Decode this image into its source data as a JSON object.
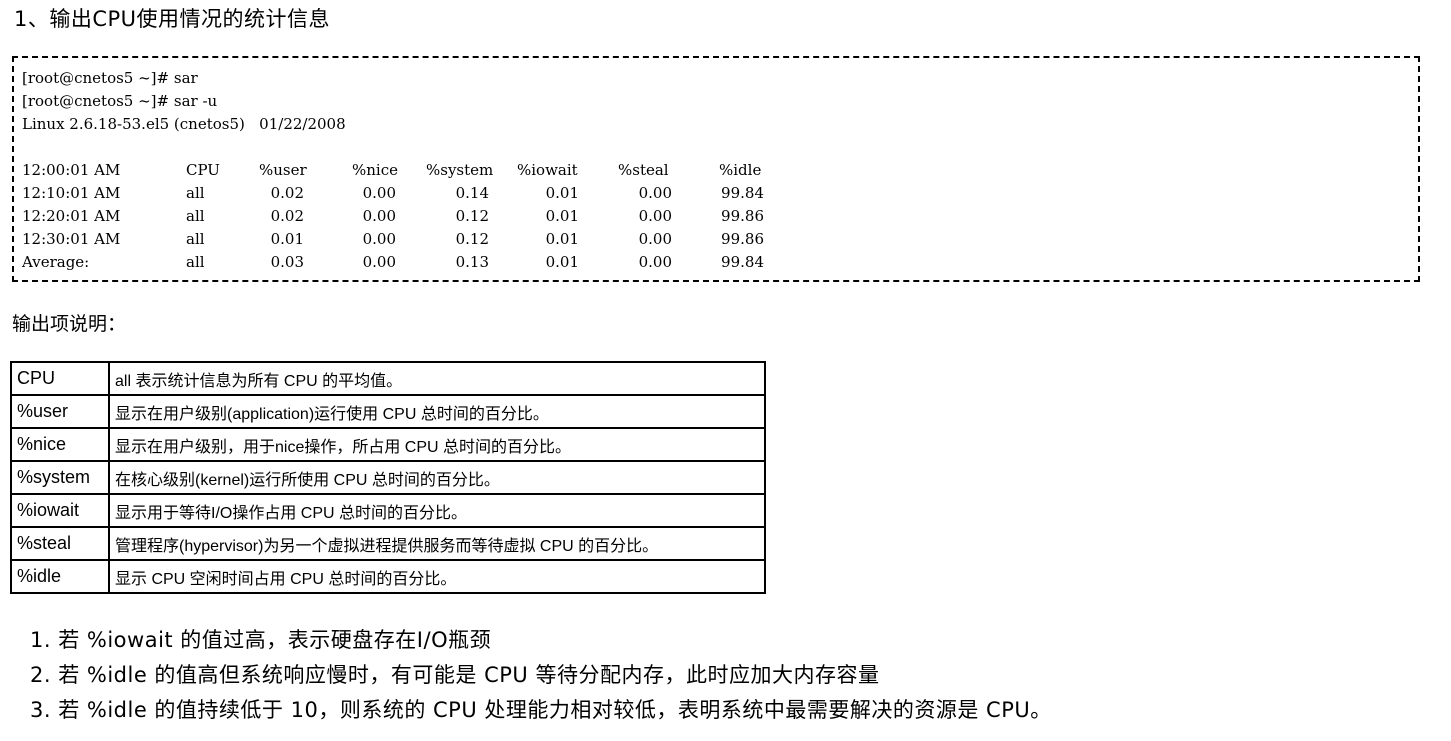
{
  "heading": "1、输出CPU使用情况的统计信息",
  "terminal": {
    "commands": [
      "[root@cnetos5 ~]# sar",
      "[root@cnetos5 ~]# sar -u"
    ],
    "sysinfo": "Linux 2.6.18-53.el5 (cnetos5)   01/22/2008",
    "columns": [
      "12:00:01 AM",
      "CPU",
      "%user",
      "%nice",
      "%system",
      "%iowait",
      "%steal",
      "%idle"
    ],
    "rows": [
      [
        "12:10:01 AM",
        "all",
        "0.02",
        "0.00",
        "0.14",
        "0.01",
        "0.00",
        "99.84"
      ],
      [
        "12:20:01 AM",
        "all",
        "0.02",
        "0.00",
        "0.12",
        "0.01",
        "0.00",
        "99.86"
      ],
      [
        "12:30:01 AM",
        "all",
        "0.01",
        "0.00",
        "0.12",
        "0.01",
        "0.00",
        "99.86"
      ],
      [
        "Average:",
        "all",
        "0.03",
        "0.00",
        "0.13",
        "0.01",
        "0.00",
        "99.84"
      ]
    ]
  },
  "subheading": "输出项说明：",
  "table": [
    {
      "key": "CPU",
      "desc": "all 表示统计信息为所有 CPU 的平均值。"
    },
    {
      "key": "%user",
      "desc": "显示在用户级别(application)运行使用 CPU 总时间的百分比。"
    },
    {
      "key": "%nice",
      "desc": "显示在用户级别，用于nice操作，所占用 CPU 总时间的百分比。"
    },
    {
      "key": "%system",
      "desc": "在核心级别(kernel)运行所使用 CPU 总时间的百分比。"
    },
    {
      "key": "%iowait",
      "desc": "显示用于等待I/O操作占用 CPU 总时间的百分比。"
    },
    {
      "key": "%steal",
      "desc": "管理程序(hypervisor)为另一个虚拟进程提供服务而等待虚拟 CPU 的百分比。"
    },
    {
      "key": "%idle",
      "desc": "显示 CPU 空闲时间占用 CPU 总时间的百分比。"
    }
  ],
  "notes": [
    "1. 若 %iowait 的值过高，表示硬盘存在I/O瓶颈",
    "2. 若 %idle 的值高但系统响应慢时，有可能是 CPU 等待分配内存，此时应加大内存容量",
    "3. 若 %idle 的值持续低于 10，则系统的 CPU 处理能力相对较低，表明系统中最需要解决的资源是 CPU。"
  ]
}
